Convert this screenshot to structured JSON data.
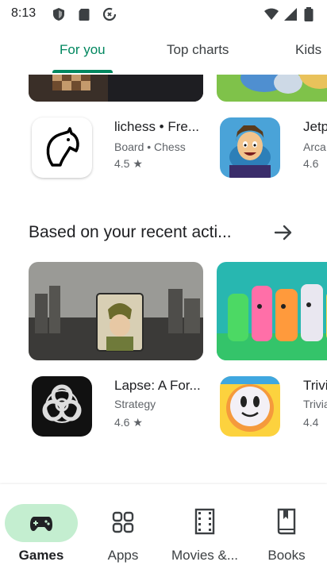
{
  "status_bar": {
    "time": "8:13",
    "left_icons": [
      "shield-icon",
      "sd-card-icon",
      "data-saver-icon"
    ],
    "right_icons": [
      "wifi-icon",
      "cell-signal-icon",
      "battery-icon"
    ]
  },
  "tabs": [
    {
      "label": "For you",
      "active": true
    },
    {
      "label": "Top charts",
      "active": false
    },
    {
      "label": "Kids",
      "active": false
    }
  ],
  "apps_row1": [
    {
      "title": "lichess • Fre...",
      "subtitle": "Board  •  Chess",
      "rating": "4.5 ★",
      "icon": "lichess-icon"
    },
    {
      "title": "Jetp",
      "subtitle": "Arca",
      "rating": "4.6 ",
      "icon": "jetpack-icon"
    }
  ],
  "section": {
    "title": "Based on your recent acti...",
    "arrow_icon": "arrow-right-icon"
  },
  "apps_row2": [
    {
      "title": "Lapse: A For...",
      "subtitle": "Strategy",
      "rating": "4.6 ★",
      "icon": "biohazard-icon"
    },
    {
      "title": "Trivi",
      "subtitle": "Trivia",
      "rating": "4.4 ",
      "icon": "trivia-icon"
    }
  ],
  "bottom_nav": [
    {
      "label": "Games",
      "icon": "gamepad-icon",
      "active": true
    },
    {
      "label": "Apps",
      "icon": "apps-grid-icon",
      "active": false
    },
    {
      "label": "Movies &...",
      "icon": "film-icon",
      "active": false
    },
    {
      "label": "Books",
      "icon": "book-icon",
      "active": false
    }
  ],
  "colors": {
    "accent": "#01875f",
    "active_pill": "#c4eed0"
  }
}
